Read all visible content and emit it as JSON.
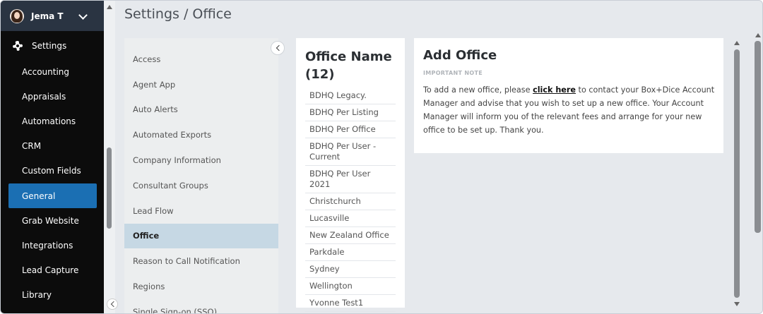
{
  "user": {
    "name": "Jema T"
  },
  "settings_label": "Settings",
  "sidebar": {
    "items": [
      {
        "label": "Accounting"
      },
      {
        "label": "Appraisals"
      },
      {
        "label": "Automations"
      },
      {
        "label": "CRM"
      },
      {
        "label": "Custom Fields"
      },
      {
        "label": "General",
        "active": true
      },
      {
        "label": "Grab Website"
      },
      {
        "label": "Integrations"
      },
      {
        "label": "Lead Capture"
      },
      {
        "label": "Library"
      }
    ]
  },
  "page": {
    "title": "Settings / Office"
  },
  "settings_menu": {
    "items": [
      {
        "label": "Access"
      },
      {
        "label": "Agent App"
      },
      {
        "label": "Auto Alerts"
      },
      {
        "label": "Automated Exports"
      },
      {
        "label": "Company Information"
      },
      {
        "label": "Consultant Groups"
      },
      {
        "label": "Lead Flow"
      },
      {
        "label": "Office",
        "active": true
      },
      {
        "label": "Reason to Call Notification"
      },
      {
        "label": "Regions"
      },
      {
        "label": "Single Sign-on (SSO)"
      }
    ]
  },
  "offices": {
    "title": "Office Name (12)",
    "items": [
      "BDHQ Legacy.",
      "BDHQ Per Listing",
      "BDHQ Per Office",
      "BDHQ Per User - Current",
      "BDHQ Per User 2021",
      "Christchurch",
      "Lucasville",
      "New Zealand Office",
      "Parkdale",
      "Sydney",
      "Wellington",
      "Yvonne Test1"
    ]
  },
  "add_office": {
    "title": "Add Office",
    "note_heading": "IMPORTANT NOTE",
    "body_before": "To add a new office, please ",
    "link": "click here",
    "body_after": " to contact your Box+Dice Account Manager and advise that you wish to set up a new office. Your Account Manager will inform you of the relevant fees and arrange for your new office to be set up. Thank you."
  },
  "colors": {
    "sidebar_bg": "#0c0c0c",
    "user_header_bg": "#2a3442",
    "active_nav": "#1b6fb3",
    "active_menu": "#c6d8e4",
    "main_bg": "#e6e9ed"
  }
}
